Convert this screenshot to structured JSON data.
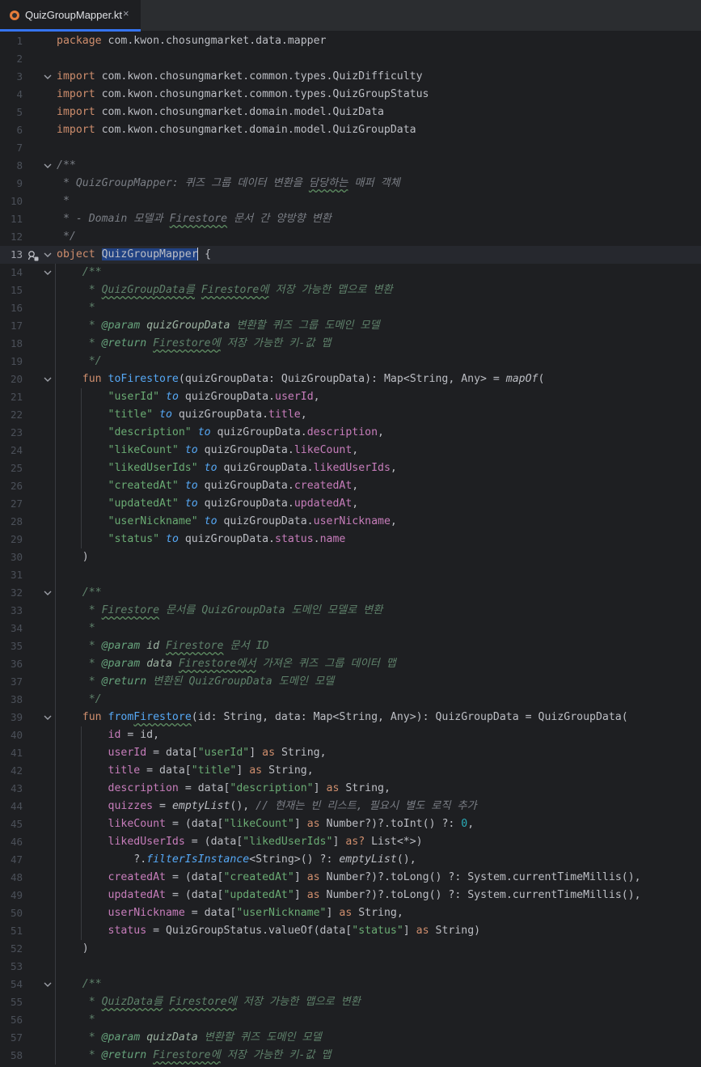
{
  "tab": {
    "filename": "QuizGroupMapper.kt",
    "close": "×"
  },
  "lines": [
    {
      "n": "1",
      "parts": [
        [
          "k",
          "package "
        ],
        [
          "t",
          "com.kwon.chosungmarket.data.mapper"
        ]
      ]
    },
    {
      "n": "2",
      "parts": []
    },
    {
      "n": "3",
      "fold": true,
      "parts": [
        [
          "k",
          "import "
        ],
        [
          "t",
          "com.kwon.chosungmarket.common.types.QuizDifficulty"
        ]
      ]
    },
    {
      "n": "4",
      "parts": [
        [
          "k",
          "import "
        ],
        [
          "t",
          "com.kwon.chosungmarket.common.types.QuizGroupStatus"
        ]
      ]
    },
    {
      "n": "5",
      "parts": [
        [
          "k",
          "import "
        ],
        [
          "t",
          "com.kwon.chosungmarket.domain.model.QuizData"
        ]
      ]
    },
    {
      "n": "6",
      "parts": [
        [
          "k",
          "import "
        ],
        [
          "t",
          "com.kwon.chosungmarket.domain.model.QuizGroupData"
        ]
      ]
    },
    {
      "n": "7",
      "parts": []
    },
    {
      "n": "8",
      "fold": true,
      "parts": [
        [
          "c",
          "/**"
        ]
      ]
    },
    {
      "n": "9",
      "parts": [
        [
          "c",
          " * QuizGroupMapper: 퀴즈 그룹 데이터 변환을 "
        ],
        [
          "cu",
          "담당하는"
        ],
        [
          "c",
          " 매퍼 객체"
        ]
      ]
    },
    {
      "n": "10",
      "parts": [
        [
          "c",
          " *"
        ]
      ]
    },
    {
      "n": "11",
      "parts": [
        [
          "c",
          " * - Domain 모델과 "
        ],
        [
          "cu",
          "Firestore"
        ],
        [
          "c",
          " 문서 간 양방향 변환"
        ]
      ]
    },
    {
      "n": "12",
      "parts": [
        [
          "c",
          " */"
        ]
      ]
    },
    {
      "n": "13",
      "fold": true,
      "current": true,
      "icon": true,
      "parts": [
        [
          "k",
          "object "
        ],
        [
          "sel",
          "QuizGroupMapper"
        ],
        [
          "caret",
          ""
        ],
        [
          "t",
          " {"
        ]
      ]
    },
    {
      "n": "14",
      "fold": true,
      "parts": [
        [
          "t",
          "    "
        ],
        [
          "d",
          "/**"
        ]
      ]
    },
    {
      "n": "15",
      "parts": [
        [
          "t",
          "    "
        ],
        [
          "d",
          " * "
        ],
        [
          "du",
          "QuizGroupData를"
        ],
        [
          "d",
          " "
        ],
        [
          "du",
          "Firestore에"
        ],
        [
          "d",
          " 저장 가능한 맵으로 변환"
        ]
      ]
    },
    {
      "n": "16",
      "parts": [
        [
          "t",
          "    "
        ],
        [
          "d",
          " *"
        ]
      ]
    },
    {
      "n": "17",
      "parts": [
        [
          "t",
          "    "
        ],
        [
          "d",
          " * "
        ],
        [
          "dt",
          "@param"
        ],
        [
          "d",
          " "
        ],
        [
          "dp",
          "quizGroupData"
        ],
        [
          "d",
          " 변환할 퀴즈 그룹 도메인 모델"
        ]
      ]
    },
    {
      "n": "18",
      "parts": [
        [
          "t",
          "    "
        ],
        [
          "d",
          " * "
        ],
        [
          "dt",
          "@return"
        ],
        [
          "d",
          " "
        ],
        [
          "du",
          "Firestore에"
        ],
        [
          "d",
          " 저장 가능한 키-값 맵"
        ]
      ]
    },
    {
      "n": "19",
      "parts": [
        [
          "t",
          "    "
        ],
        [
          "d",
          " */"
        ]
      ]
    },
    {
      "n": "20",
      "fold": true,
      "parts": [
        [
          "t",
          "    "
        ],
        [
          "k",
          "fun "
        ],
        [
          "f",
          "toFirestore"
        ],
        [
          "t",
          "(quizGroupData: QuizGroupData): Map<String, Any> = "
        ],
        [
          "i",
          "mapOf"
        ],
        [
          "t",
          "("
        ]
      ]
    },
    {
      "n": "21",
      "parts": [
        [
          "t",
          "        "
        ],
        [
          "s",
          "\"userId\""
        ],
        [
          "t",
          " "
        ],
        [
          "inf",
          "to"
        ],
        [
          "t",
          " quizGroupData."
        ],
        [
          "p",
          "userId"
        ],
        [
          "t",
          ","
        ]
      ]
    },
    {
      "n": "22",
      "parts": [
        [
          "t",
          "        "
        ],
        [
          "s",
          "\"title\""
        ],
        [
          "t",
          " "
        ],
        [
          "inf",
          "to"
        ],
        [
          "t",
          " quizGroupData."
        ],
        [
          "p",
          "title"
        ],
        [
          "t",
          ","
        ]
      ]
    },
    {
      "n": "23",
      "parts": [
        [
          "t",
          "        "
        ],
        [
          "s",
          "\"description\""
        ],
        [
          "t",
          " "
        ],
        [
          "inf",
          "to"
        ],
        [
          "t",
          " quizGroupData."
        ],
        [
          "p",
          "description"
        ],
        [
          "t",
          ","
        ]
      ]
    },
    {
      "n": "24",
      "parts": [
        [
          "t",
          "        "
        ],
        [
          "s",
          "\"likeCount\""
        ],
        [
          "t",
          " "
        ],
        [
          "inf",
          "to"
        ],
        [
          "t",
          " quizGroupData."
        ],
        [
          "p",
          "likeCount"
        ],
        [
          "t",
          ","
        ]
      ]
    },
    {
      "n": "25",
      "parts": [
        [
          "t",
          "        "
        ],
        [
          "s",
          "\"likedUserIds\""
        ],
        [
          "t",
          " "
        ],
        [
          "inf",
          "to"
        ],
        [
          "t",
          " quizGroupData."
        ],
        [
          "p",
          "likedUserIds"
        ],
        [
          "t",
          ","
        ]
      ]
    },
    {
      "n": "26",
      "parts": [
        [
          "t",
          "        "
        ],
        [
          "s",
          "\"createdAt\""
        ],
        [
          "t",
          " "
        ],
        [
          "inf",
          "to"
        ],
        [
          "t",
          " quizGroupData."
        ],
        [
          "p",
          "createdAt"
        ],
        [
          "t",
          ","
        ]
      ]
    },
    {
      "n": "27",
      "parts": [
        [
          "t",
          "        "
        ],
        [
          "s",
          "\"updatedAt\""
        ],
        [
          "t",
          " "
        ],
        [
          "inf",
          "to"
        ],
        [
          "t",
          " quizGroupData."
        ],
        [
          "p",
          "updatedAt"
        ],
        [
          "t",
          ","
        ]
      ]
    },
    {
      "n": "28",
      "parts": [
        [
          "t",
          "        "
        ],
        [
          "s",
          "\"userNickname\""
        ],
        [
          "t",
          " "
        ],
        [
          "inf",
          "to"
        ],
        [
          "t",
          " quizGroupData."
        ],
        [
          "p",
          "userNickname"
        ],
        [
          "t",
          ","
        ]
      ]
    },
    {
      "n": "29",
      "parts": [
        [
          "t",
          "        "
        ],
        [
          "s",
          "\"status\""
        ],
        [
          "t",
          " "
        ],
        [
          "inf",
          "to"
        ],
        [
          "t",
          " quizGroupData."
        ],
        [
          "p",
          "status"
        ],
        [
          "t",
          "."
        ],
        [
          "p",
          "name"
        ]
      ]
    },
    {
      "n": "30",
      "parts": [
        [
          "t",
          "    )"
        ]
      ]
    },
    {
      "n": "31",
      "parts": []
    },
    {
      "n": "32",
      "fold": true,
      "parts": [
        [
          "t",
          "    "
        ],
        [
          "d",
          "/**"
        ]
      ]
    },
    {
      "n": "33",
      "parts": [
        [
          "t",
          "    "
        ],
        [
          "d",
          " * "
        ],
        [
          "du",
          "Firestore"
        ],
        [
          "d",
          " 문서를 QuizGroupData 도메인 모델로 변환"
        ]
      ]
    },
    {
      "n": "34",
      "parts": [
        [
          "t",
          "    "
        ],
        [
          "d",
          " *"
        ]
      ]
    },
    {
      "n": "35",
      "parts": [
        [
          "t",
          "    "
        ],
        [
          "d",
          " * "
        ],
        [
          "dt",
          "@param"
        ],
        [
          "d",
          " "
        ],
        [
          "dp",
          "id"
        ],
        [
          "d",
          " "
        ],
        [
          "du",
          "Firestore"
        ],
        [
          "d",
          " 문서 ID"
        ]
      ]
    },
    {
      "n": "36",
      "parts": [
        [
          "t",
          "    "
        ],
        [
          "d",
          " * "
        ],
        [
          "dt",
          "@param"
        ],
        [
          "d",
          " "
        ],
        [
          "dp",
          "data"
        ],
        [
          "d",
          " "
        ],
        [
          "du",
          "Firestore에서"
        ],
        [
          "d",
          " 가져온 퀴즈 그룹 데이터 맵"
        ]
      ]
    },
    {
      "n": "37",
      "parts": [
        [
          "t",
          "    "
        ],
        [
          "d",
          " * "
        ],
        [
          "dt",
          "@return"
        ],
        [
          "d",
          " 변환된 QuizGroupData 도메인 모델"
        ]
      ]
    },
    {
      "n": "38",
      "parts": [
        [
          "t",
          "    "
        ],
        [
          "d",
          " */"
        ]
      ]
    },
    {
      "n": "39",
      "fold": true,
      "parts": [
        [
          "t",
          "    "
        ],
        [
          "k",
          "fun "
        ],
        [
          "fu",
          "fromFirestore"
        ],
        [
          "t",
          "(id: String, data: Map<String, Any>): QuizGroupData = QuizGroupData("
        ]
      ]
    },
    {
      "n": "40",
      "parts": [
        [
          "t",
          "        "
        ],
        [
          "nm",
          "id"
        ],
        [
          "t",
          " = id,"
        ]
      ]
    },
    {
      "n": "41",
      "parts": [
        [
          "t",
          "        "
        ],
        [
          "nm",
          "userId"
        ],
        [
          "t",
          " = data["
        ],
        [
          "s",
          "\"userId\""
        ],
        [
          "t",
          "] "
        ],
        [
          "k",
          "as"
        ],
        [
          "t",
          " String,"
        ]
      ]
    },
    {
      "n": "42",
      "parts": [
        [
          "t",
          "        "
        ],
        [
          "nm",
          "title"
        ],
        [
          "t",
          " = data["
        ],
        [
          "s",
          "\"title\""
        ],
        [
          "t",
          "] "
        ],
        [
          "k",
          "as"
        ],
        [
          "t",
          " String,"
        ]
      ]
    },
    {
      "n": "43",
      "parts": [
        [
          "t",
          "        "
        ],
        [
          "nm",
          "description"
        ],
        [
          "t",
          " = data["
        ],
        [
          "s",
          "\"description\""
        ],
        [
          "t",
          "] "
        ],
        [
          "k",
          "as"
        ],
        [
          "t",
          " String,"
        ]
      ]
    },
    {
      "n": "44",
      "parts": [
        [
          "t",
          "        "
        ],
        [
          "nm",
          "quizzes"
        ],
        [
          "t",
          " = "
        ],
        [
          "i",
          "emptyList"
        ],
        [
          "t",
          "(), "
        ],
        [
          "c",
          "// 현재는 빈 리스트, 필요시 별도 로직 추가"
        ]
      ]
    },
    {
      "n": "45",
      "parts": [
        [
          "t",
          "        "
        ],
        [
          "nm",
          "likeCount"
        ],
        [
          "t",
          " = (data["
        ],
        [
          "s",
          "\"likeCount\""
        ],
        [
          "t",
          "] "
        ],
        [
          "k",
          "as"
        ],
        [
          "t",
          " Number?)?.toInt() ?: "
        ],
        [
          "n",
          "0"
        ],
        [
          "t",
          ","
        ]
      ]
    },
    {
      "n": "46",
      "parts": [
        [
          "t",
          "        "
        ],
        [
          "nm",
          "likedUserIds"
        ],
        [
          "t",
          " = (data["
        ],
        [
          "s",
          "\"likedUserIds\""
        ],
        [
          "t",
          "] "
        ],
        [
          "k",
          "as?"
        ],
        [
          "t",
          " List<*>)"
        ]
      ]
    },
    {
      "n": "47",
      "parts": [
        [
          "t",
          "            ?."
        ],
        [
          "inf",
          "filterIsInstance"
        ],
        [
          "t",
          "<String>() ?: "
        ],
        [
          "i",
          "emptyList"
        ],
        [
          "t",
          "(),"
        ]
      ]
    },
    {
      "n": "48",
      "parts": [
        [
          "t",
          "        "
        ],
        [
          "nm",
          "createdAt"
        ],
        [
          "t",
          " = (data["
        ],
        [
          "s",
          "\"createdAt\""
        ],
        [
          "t",
          "] "
        ],
        [
          "k",
          "as"
        ],
        [
          "t",
          " Number?)?.toLong() ?: System.currentTimeMillis(),"
        ]
      ]
    },
    {
      "n": "49",
      "parts": [
        [
          "t",
          "        "
        ],
        [
          "nm",
          "updatedAt"
        ],
        [
          "t",
          " = (data["
        ],
        [
          "s",
          "\"updatedAt\""
        ],
        [
          "t",
          "] "
        ],
        [
          "k",
          "as"
        ],
        [
          "t",
          " Number?)?.toLong() ?: System.currentTimeMillis(),"
        ]
      ]
    },
    {
      "n": "50",
      "parts": [
        [
          "t",
          "        "
        ],
        [
          "nm",
          "userNickname"
        ],
        [
          "t",
          " = data["
        ],
        [
          "s",
          "\"userNickname\""
        ],
        [
          "t",
          "] "
        ],
        [
          "k",
          "as"
        ],
        [
          "t",
          " String,"
        ]
      ]
    },
    {
      "n": "51",
      "parts": [
        [
          "t",
          "        "
        ],
        [
          "nm",
          "status"
        ],
        [
          "t",
          " = QuizGroupStatus.valueOf(data["
        ],
        [
          "s",
          "\"status\""
        ],
        [
          "t",
          "] "
        ],
        [
          "k",
          "as"
        ],
        [
          "t",
          " String)"
        ]
      ]
    },
    {
      "n": "52",
      "parts": [
        [
          "t",
          "    )"
        ]
      ]
    },
    {
      "n": "53",
      "parts": []
    },
    {
      "n": "54",
      "fold": true,
      "parts": [
        [
          "t",
          "    "
        ],
        [
          "d",
          "/**"
        ]
      ]
    },
    {
      "n": "55",
      "parts": [
        [
          "t",
          "    "
        ],
        [
          "d",
          " * "
        ],
        [
          "du",
          "QuizData를"
        ],
        [
          "d",
          " "
        ],
        [
          "du",
          "Firestore에"
        ],
        [
          "d",
          " 저장 가능한 맵으로 변환"
        ]
      ]
    },
    {
      "n": "56",
      "parts": [
        [
          "t",
          "    "
        ],
        [
          "d",
          " *"
        ]
      ]
    },
    {
      "n": "57",
      "parts": [
        [
          "t",
          "    "
        ],
        [
          "d",
          " * "
        ],
        [
          "dt",
          "@param"
        ],
        [
          "d",
          " "
        ],
        [
          "dp",
          "quizData"
        ],
        [
          "d",
          " 변환할 퀴즈 도메인 모델"
        ]
      ]
    },
    {
      "n": "58",
      "parts": [
        [
          "t",
          "    "
        ],
        [
          "d",
          " * "
        ],
        [
          "dt",
          "@return"
        ],
        [
          "d",
          " "
        ],
        [
          "du",
          "Firestore에"
        ],
        [
          "d",
          " 저장 가능한 키-값 맵"
        ]
      ]
    }
  ]
}
